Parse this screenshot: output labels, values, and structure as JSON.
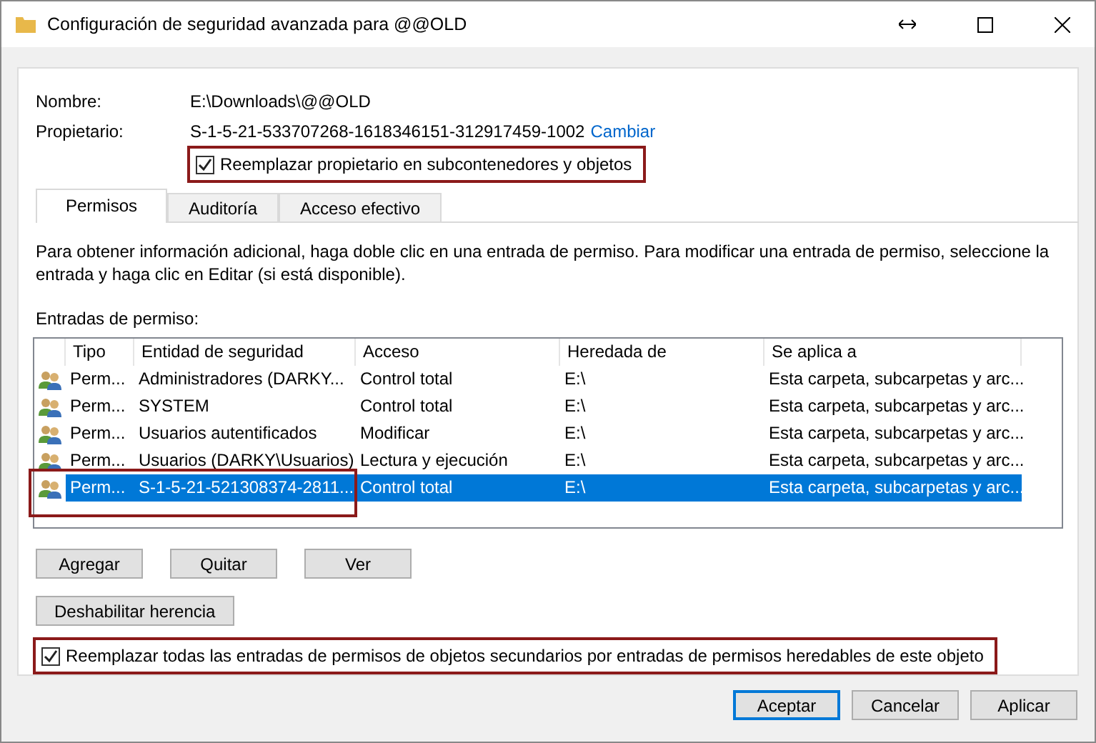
{
  "window": {
    "title": "Configuración de seguridad avanzada para @@OLD"
  },
  "fields": [
    {
      "label": "Nombre:",
      "value": "E:\\Downloads\\@@OLD"
    },
    {
      "label": "Propietario:",
      "value": "S-1-5-21-533707268-1618346151-312917459-1002",
      "link": "Cambiar"
    }
  ],
  "owner_checkbox": {
    "label": "Reemplazar propietario en subcontenedores y objetos",
    "checked": true,
    "highlighted": true
  },
  "tabs": [
    {
      "label": "Permisos",
      "selected": true
    },
    {
      "label": "Auditoría",
      "selected": false
    },
    {
      "label": "Acceso efectivo",
      "selected": false
    }
  ],
  "info": "Para obtener información adicional, haga doble clic en una entrada de permiso. Para modificar una entrada de permiso, seleccione la entrada y haga clic en Editar (si está disponible).",
  "list_label": "Entradas de permiso:",
  "table": {
    "columns": [
      "Tipo",
      "Entidad de seguridad",
      "Acceso",
      "Heredada de",
      "Se aplica a"
    ],
    "rows": [
      {
        "cells": [
          "Perm...",
          "Administradores (DARKY...",
          "Control total",
          "E:\\",
          "Esta carpeta, subcarpetas y arc..."
        ],
        "selected": false,
        "highlighted": false
      },
      {
        "cells": [
          "Perm...",
          "SYSTEM",
          "Control total",
          "E:\\",
          "Esta carpeta, subcarpetas y arc..."
        ],
        "selected": false,
        "highlighted": false
      },
      {
        "cells": [
          "Perm...",
          "Usuarios autentificados",
          "Modificar",
          "E:\\",
          "Esta carpeta, subcarpetas y arc..."
        ],
        "selected": false,
        "highlighted": false
      },
      {
        "cells": [
          "Perm...",
          "Usuarios (DARKY\\Usuarios)",
          "Lectura y ejecución",
          "E:\\",
          "Esta carpeta, subcarpetas y arc..."
        ],
        "selected": false,
        "highlighted": false
      },
      {
        "cells": [
          "Perm...",
          "S-1-5-21-521308374-2811...",
          "Control total",
          "E:\\",
          "Esta carpeta, subcarpetas y arc..."
        ],
        "selected": true,
        "highlighted": true
      }
    ]
  },
  "list_buttons": [
    "Agregar",
    "Quitar",
    "Ver"
  ],
  "inheritance_button": "Deshabilitar herencia",
  "replace_checkbox": {
    "label": "Reemplazar todas las entradas de permisos de objetos secundarios por entradas de permisos heredables de este objeto",
    "checked": true,
    "highlighted": true
  },
  "buttons": [
    {
      "label": "Aceptar",
      "default": true
    },
    {
      "label": "Cancelar",
      "default": false
    },
    {
      "label": "Aplicar",
      "default": false
    }
  ]
}
